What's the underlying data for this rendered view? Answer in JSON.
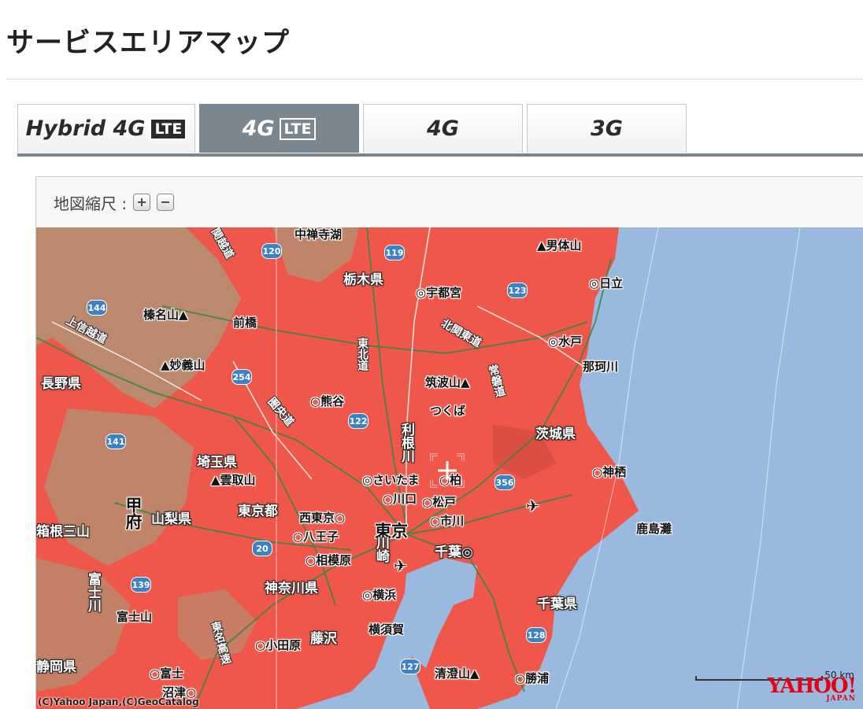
{
  "page": {
    "title": "サービスエリアマップ"
  },
  "tabs": [
    {
      "label": "Hybrid 4G",
      "badge": "LTE",
      "active": false
    },
    {
      "label": "4G",
      "badge": "LTE",
      "active": true
    },
    {
      "label": "4G",
      "badge": "",
      "active": false
    },
    {
      "label": "3G",
      "badge": "",
      "active": false
    }
  ],
  "zoom": {
    "label": "地図縮尺 :",
    "plus": "+",
    "minus": "−"
  },
  "map": {
    "colors": {
      "coverage": "#f0574b",
      "sea": "#9ab9de",
      "terrain": "#8fb28a"
    },
    "place_labels": {
      "chuzenji": "中禅寺湖",
      "tochigi": "栃木県",
      "utsunomiya": "◎宇都宮",
      "nantai": "▲男体山",
      "hitachi": "◎日立",
      "haruna": "榛名山▲",
      "maebashi": "前橋",
      "mito": "◎水戸",
      "naka": "那珂川",
      "myogi": "▲妙義山",
      "nagano": "長野県",
      "kumagaya": "○熊谷",
      "tsukuba_san": "筑波山▲",
      "tsukuba": "つくば",
      "ibaraki": "茨城県",
      "tone": "利根川",
      "saitama_pref": "埼玉県",
      "kumotori": "▲雲取山",
      "saitama": "◎さいたま",
      "kashiwa": "○柏",
      "kamisu": "○神栖",
      "kawaguchi": "○川口",
      "matsudo": "○松戸",
      "kofu": "甲府",
      "yamanashi": "山梨県",
      "tokyo_pref": "東京都",
      "nishitokyo": "西東京○",
      "ichikawa": "○市川",
      "tokyo": "東京",
      "hachioji": "○八王子",
      "kashimanada": "鹿島灘",
      "chiba": "千葉◎",
      "sagamihara": "○相模原",
      "kawasaki": "川崎",
      "kanagawa": "神奈川県",
      "yokohama": "◎横浜",
      "chiba_pref": "千葉県",
      "fujisan": "富士山",
      "fujikawa": "富士川",
      "yokosuka": "横須賀",
      "odawara": "○小田原",
      "fujisawa": "藤沢",
      "shizuoka": "静岡県",
      "fuji": "○富士",
      "numazu": "沼津○",
      "kiyosumi": "清澄山▲",
      "katsuura": "○勝浦",
      "hakone": "箱根三山",
      "shin_etsu": "上信越道",
      "kan_etsu": "関越道",
      "kita_kanto": "北関東道",
      "tohoku": "東北道",
      "joban": "常磐道",
      "ken_o": "圏央道",
      "tomei": "東名高速"
    },
    "route_shields": [
      "120",
      "119",
      "144",
      "123",
      "254",
      "122",
      "141",
      "356",
      "20",
      "139",
      "128",
      "127"
    ],
    "scale": "50 km",
    "copyright": "(C)Yahoo Japan,(C)GeoCatalog",
    "logo": "YAHOO!",
    "logo_sub": "JAPAN"
  }
}
